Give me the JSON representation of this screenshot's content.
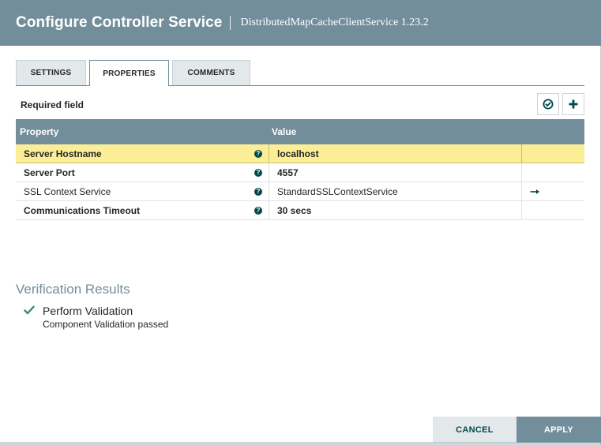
{
  "header": {
    "title": "Configure Controller Service",
    "subtitle": "DistributedMapCacheClientService 1.23.2"
  },
  "tabs": [
    {
      "label": "SETTINGS",
      "active": false
    },
    {
      "label": "PROPERTIES",
      "active": true
    },
    {
      "label": "COMMENTS",
      "active": false
    }
  ],
  "properties": {
    "required_label": "Required field",
    "toolbar": {
      "verify_icon": "check-circle-icon",
      "add_icon": "plus-icon"
    },
    "columns": {
      "property": "Property",
      "value": "Value"
    },
    "rows": [
      {
        "name": "Server Hostname",
        "value": "localhost",
        "required": true,
        "selected": true,
        "action": ""
      },
      {
        "name": "Server Port",
        "value": "4557",
        "required": true,
        "selected": false,
        "action": ""
      },
      {
        "name": "SSL Context Service",
        "value": "StandardSSLContextService",
        "required": false,
        "selected": false,
        "action": "arrow-right-icon"
      },
      {
        "name": "Communications Timeout",
        "value": "30 secs",
        "required": true,
        "selected": false,
        "action": ""
      }
    ]
  },
  "verification": {
    "title": "Verification Results",
    "items": [
      {
        "name": "Perform Validation",
        "detail": "Component Validation passed",
        "status": "success"
      }
    ]
  },
  "footer": {
    "cancel_label": "CANCEL",
    "apply_label": "APPLY"
  },
  "colors": {
    "header": "#728e9b",
    "selected_row": "#fcee96",
    "accent": "#004849",
    "success": "#3e8a6e"
  }
}
